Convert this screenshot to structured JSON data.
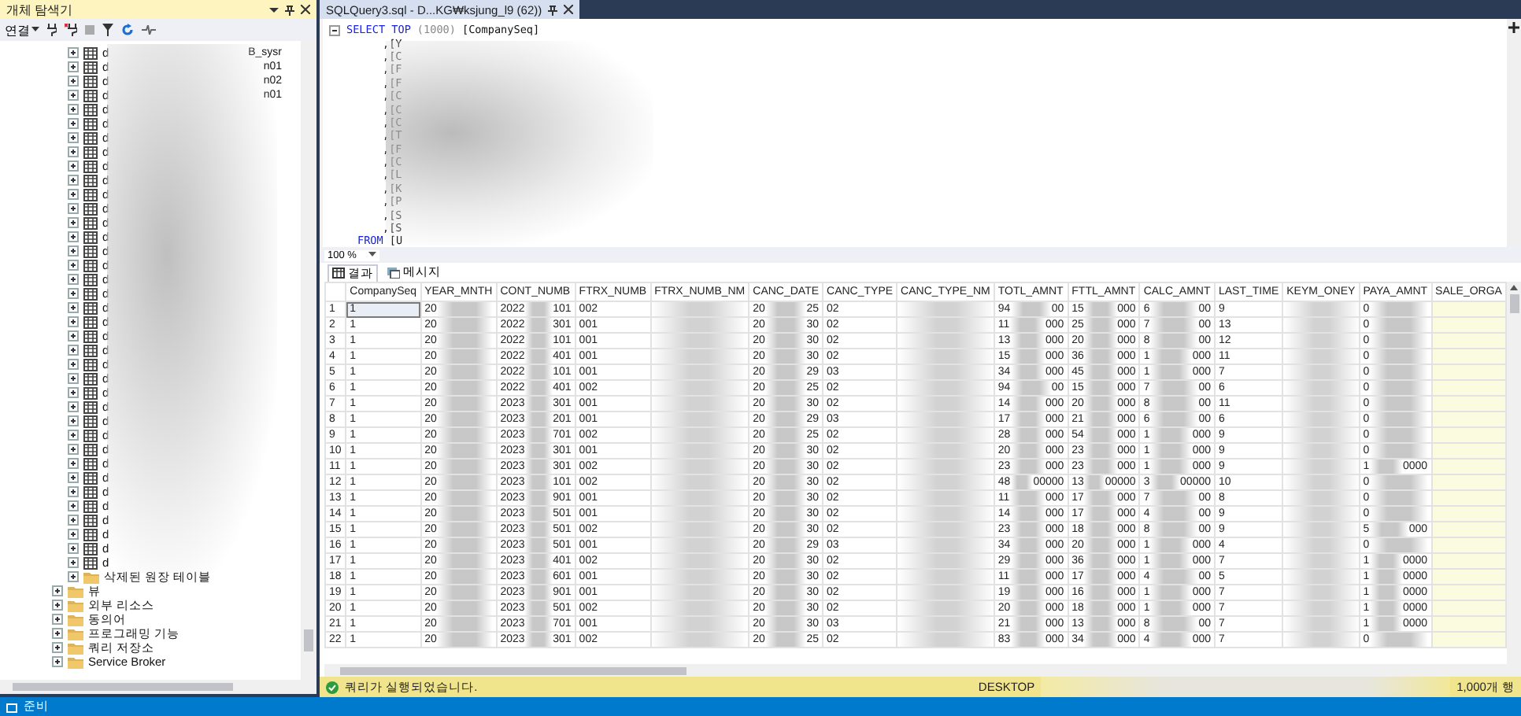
{
  "object_explorer": {
    "title": "개체 탐색기",
    "connect_label": "연결",
    "inner_items": [
      {
        "kind": "table",
        "label": "d",
        "suffix": "B_sysr"
      },
      {
        "kind": "table",
        "label": "d",
        "suffix": "n01"
      },
      {
        "kind": "table",
        "label": "d",
        "suffix": "n02"
      },
      {
        "kind": "table",
        "label": "d",
        "suffix": "n01"
      },
      {
        "kind": "table",
        "label": "d"
      },
      {
        "kind": "table",
        "label": "d"
      },
      {
        "kind": "table",
        "label": "d"
      },
      {
        "kind": "table",
        "label": "d"
      },
      {
        "kind": "table",
        "label": "d"
      },
      {
        "kind": "table",
        "label": "d"
      },
      {
        "kind": "table",
        "label": "d"
      },
      {
        "kind": "table",
        "label": "d"
      },
      {
        "kind": "table",
        "label": "d"
      },
      {
        "kind": "table",
        "label": "d"
      },
      {
        "kind": "table",
        "label": "d"
      },
      {
        "kind": "table",
        "label": "d"
      },
      {
        "kind": "table",
        "label": "d"
      },
      {
        "kind": "table",
        "label": "d"
      },
      {
        "kind": "table",
        "label": "d"
      },
      {
        "kind": "table",
        "label": "d"
      },
      {
        "kind": "table",
        "label": "d"
      },
      {
        "kind": "table",
        "label": "d"
      },
      {
        "kind": "table",
        "label": "d"
      },
      {
        "kind": "table",
        "label": "d"
      },
      {
        "kind": "table",
        "label": "d"
      },
      {
        "kind": "table",
        "label": "d"
      },
      {
        "kind": "table",
        "label": "d"
      },
      {
        "kind": "table",
        "label": "d"
      },
      {
        "kind": "table",
        "label": "d"
      },
      {
        "kind": "table",
        "label": "d"
      },
      {
        "kind": "table",
        "label": "d"
      },
      {
        "kind": "table",
        "label": "d"
      },
      {
        "kind": "table",
        "label": "d"
      },
      {
        "kind": "table",
        "label": "d"
      },
      {
        "kind": "table",
        "label": "d"
      },
      {
        "kind": "table",
        "label": "d"
      },
      {
        "kind": "table",
        "label": "d"
      },
      {
        "kind": "folder",
        "label": "삭제된 원장 테이블"
      }
    ],
    "outer_items": [
      {
        "kind": "folder",
        "label": "뷰"
      },
      {
        "kind": "folder",
        "label": "외부 리소스"
      },
      {
        "kind": "folder",
        "label": "동의어"
      },
      {
        "kind": "folder",
        "label": "프로그래밍 기능"
      },
      {
        "kind": "folder",
        "label": "쿼리 저장소"
      },
      {
        "kind": "folder",
        "label": "Service Broker"
      }
    ]
  },
  "editor": {
    "tab_title": "SQLQuery3.sql - D...KG₩ksjung_l9 (62))",
    "lines": [
      {
        "kind": "select",
        "collapsible": true,
        "parts": [
          {
            "kind": "keyword",
            "text": "SELECT TOP"
          },
          {
            "kind": "paren",
            "text": "(1000)"
          },
          {
            "kind": "plain",
            "text": "[CompanySeq]"
          }
        ]
      },
      {
        "kind": "column",
        "collapsible": false,
        "parts": [
          {
            "kind": "plain",
            "text": ",[Y"
          }
        ]
      },
      {
        "kind": "column",
        "collapsible": false,
        "parts": [
          {
            "kind": "plain",
            "text": ",[C"
          }
        ]
      },
      {
        "kind": "column",
        "collapsible": false,
        "parts": [
          {
            "kind": "plain",
            "text": ",[F"
          }
        ]
      },
      {
        "kind": "column",
        "collapsible": false,
        "parts": [
          {
            "kind": "plain",
            "text": ",[F"
          }
        ]
      },
      {
        "kind": "column",
        "collapsible": false,
        "parts": [
          {
            "kind": "plain",
            "text": ",[C"
          }
        ]
      },
      {
        "kind": "column",
        "collapsible": false,
        "parts": [
          {
            "kind": "plain",
            "text": ",[C"
          }
        ]
      },
      {
        "kind": "column",
        "collapsible": false,
        "parts": [
          {
            "kind": "plain",
            "text": ",[C"
          }
        ]
      },
      {
        "kind": "column",
        "collapsible": false,
        "parts": [
          {
            "kind": "plain",
            "text": ",[T"
          }
        ]
      },
      {
        "kind": "column",
        "collapsible": false,
        "parts": [
          {
            "kind": "plain",
            "text": ",[F"
          }
        ]
      },
      {
        "kind": "column",
        "collapsible": false,
        "parts": [
          {
            "kind": "plain",
            "text": ",[C"
          }
        ]
      },
      {
        "kind": "column",
        "collapsible": false,
        "parts": [
          {
            "kind": "plain",
            "text": ",[L"
          }
        ]
      },
      {
        "kind": "column",
        "collapsible": false,
        "parts": [
          {
            "kind": "plain",
            "text": ",[K"
          }
        ]
      },
      {
        "kind": "column",
        "collapsible": false,
        "parts": [
          {
            "kind": "plain",
            "text": ",[P"
          }
        ]
      },
      {
        "kind": "column",
        "collapsible": false,
        "parts": [
          {
            "kind": "plain",
            "text": ",[S"
          }
        ]
      },
      {
        "kind": "column",
        "collapsible": false,
        "parts": [
          {
            "kind": "plain",
            "text": ",[S"
          }
        ]
      },
      {
        "kind": "from",
        "collapsible": false,
        "parts": [
          {
            "kind": "keyword",
            "text": "FROM"
          },
          {
            "kind": "plain",
            "text": "[U"
          }
        ]
      }
    ],
    "zoom": "100 %"
  },
  "results": {
    "tabs": [
      {
        "kind": "grid",
        "label": "결과",
        "selected": true
      },
      {
        "kind": "messages",
        "label": "메시지",
        "selected": false
      }
    ],
    "columns": [
      {
        "name": "CompanySeq",
        "kind": "text"
      },
      {
        "name": "YEAR_MNTH",
        "kind": "redacted"
      },
      {
        "name": "CONT_NUMB",
        "kind": "redacted"
      },
      {
        "name": "FTRX_NUMB",
        "kind": "text"
      },
      {
        "name": "FTRX_NUMB_NM",
        "kind": "masked"
      },
      {
        "name": "CANC_DATE",
        "kind": "redacted"
      },
      {
        "name": "CANC_TYPE",
        "kind": "text"
      },
      {
        "name": "CANC_TYPE_NM",
        "kind": "masked"
      },
      {
        "name": "TOTL_AMNT",
        "kind": "redacted"
      },
      {
        "name": "FTTL_AMNT",
        "kind": "redacted"
      },
      {
        "name": "CALC_AMNT",
        "kind": "redacted"
      },
      {
        "name": "LAST_TIME",
        "kind": "text"
      },
      {
        "name": "KEYM_ONEY",
        "kind": "masked"
      },
      {
        "name": "PAYA_AMNT",
        "kind": "redacted"
      },
      {
        "name": "SALE_ORGA",
        "kind": "highlight"
      }
    ],
    "rows": [
      {
        "number": "1",
        "selected": true,
        "cells": [
          "1",
          "20",
          [
            "2022",
            "101"
          ],
          "002",
          "",
          [
            "20",
            "25"
          ],
          "02",
          "",
          [
            "94",
            "00"
          ],
          [
            "15",
            "000"
          ],
          [
            "6",
            "00"
          ],
          "9",
          "",
          "0",
          ""
        ]
      },
      {
        "number": "2",
        "selected": false,
        "cells": [
          "1",
          "20",
          [
            "2022",
            "301"
          ],
          "001",
          "",
          [
            "20",
            "30"
          ],
          "02",
          "",
          [
            "11",
            "000"
          ],
          [
            "25",
            "000"
          ],
          [
            "7",
            "00"
          ],
          "13",
          "",
          "0",
          ""
        ]
      },
      {
        "number": "3",
        "selected": false,
        "cells": [
          "1",
          "20",
          [
            "2022",
            "101"
          ],
          "001",
          "",
          [
            "20",
            "30"
          ],
          "02",
          "",
          [
            "13",
            "000"
          ],
          [
            "20",
            "000"
          ],
          [
            "8",
            "00"
          ],
          "12",
          "",
          "0",
          ""
        ]
      },
      {
        "number": "4",
        "selected": false,
        "cells": [
          "1",
          "20",
          [
            "2022",
            "401"
          ],
          "001",
          "",
          [
            "20",
            "30"
          ],
          "02",
          "",
          [
            "15",
            "000"
          ],
          [
            "36",
            "000"
          ],
          [
            "1",
            "000"
          ],
          "11",
          "",
          "0",
          ""
        ]
      },
      {
        "number": "5",
        "selected": false,
        "cells": [
          "1",
          "20",
          [
            "2022",
            "101"
          ],
          "001",
          "",
          [
            "20",
            "29"
          ],
          "03",
          "",
          [
            "34",
            "000"
          ],
          [
            "45",
            "000"
          ],
          [
            "1",
            "000"
          ],
          "7",
          "",
          "0",
          ""
        ]
      },
      {
        "number": "6",
        "selected": false,
        "cells": [
          "1",
          "20",
          [
            "2022",
            "401"
          ],
          "002",
          "",
          [
            "20",
            "25"
          ],
          "02",
          "",
          [
            "94",
            "00"
          ],
          [
            "15",
            "000"
          ],
          [
            "7",
            "00"
          ],
          "6",
          "",
          "0",
          ""
        ]
      },
      {
        "number": "7",
        "selected": false,
        "cells": [
          "1",
          "20",
          [
            "2023",
            "301"
          ],
          "001",
          "",
          [
            "20",
            "30"
          ],
          "02",
          "",
          [
            "14",
            "000"
          ],
          [
            "20",
            "000"
          ],
          [
            "8",
            "00"
          ],
          "11",
          "",
          "0",
          ""
        ]
      },
      {
        "number": "8",
        "selected": false,
        "cells": [
          "1",
          "20",
          [
            "2023",
            "201"
          ],
          "001",
          "",
          [
            "20",
            "29"
          ],
          "03",
          "",
          [
            "17",
            "000"
          ],
          [
            "21",
            "000"
          ],
          [
            "6",
            "00"
          ],
          "6",
          "",
          "0",
          ""
        ]
      },
      {
        "number": "9",
        "selected": false,
        "cells": [
          "1",
          "20",
          [
            "2023",
            "701"
          ],
          "002",
          "",
          [
            "20",
            "25"
          ],
          "02",
          "",
          [
            "28",
            "000"
          ],
          [
            "54",
            "000"
          ],
          [
            "1",
            "000"
          ],
          "9",
          "",
          "0",
          ""
        ]
      },
      {
        "number": "10",
        "selected": false,
        "cells": [
          "1",
          "20",
          [
            "2023",
            "301"
          ],
          "001",
          "",
          [
            "20",
            "30"
          ],
          "02",
          "",
          [
            "20",
            "000"
          ],
          [
            "23",
            "000"
          ],
          [
            "1",
            "000"
          ],
          "9",
          "",
          "0",
          ""
        ]
      },
      {
        "number": "11",
        "selected": false,
        "cells": [
          "1",
          "20",
          [
            "2023",
            "301"
          ],
          "002",
          "",
          [
            "20",
            "30"
          ],
          "02",
          "",
          [
            "23",
            "000"
          ],
          [
            "23",
            "000"
          ],
          [
            "1",
            "000"
          ],
          "9",
          "",
          [
            "1",
            "0000"
          ],
          ""
        ]
      },
      {
        "number": "12",
        "selected": false,
        "cells": [
          "1",
          "20",
          [
            "2023",
            "101"
          ],
          "002",
          "",
          [
            "20",
            "30"
          ],
          "02",
          "",
          [
            "48",
            "00000"
          ],
          [
            "13",
            "00000"
          ],
          [
            "3",
            "00000"
          ],
          "10",
          "",
          "0",
          ""
        ]
      },
      {
        "number": "13",
        "selected": false,
        "cells": [
          "1",
          "20",
          [
            "2023",
            "901"
          ],
          "001",
          "",
          [
            "20",
            "30"
          ],
          "02",
          "",
          [
            "11",
            "000"
          ],
          [
            "17",
            "000"
          ],
          [
            "7",
            "00"
          ],
          "8",
          "",
          "0",
          ""
        ]
      },
      {
        "number": "14",
        "selected": false,
        "cells": [
          "1",
          "20",
          [
            "2023",
            "501"
          ],
          "001",
          "",
          [
            "20",
            "30"
          ],
          "02",
          "",
          [
            "14",
            "000"
          ],
          [
            "17",
            "000"
          ],
          [
            "4",
            "00"
          ],
          "9",
          "",
          "0",
          ""
        ]
      },
      {
        "number": "15",
        "selected": false,
        "cells": [
          "1",
          "20",
          [
            "2023",
            "501"
          ],
          "002",
          "",
          [
            "20",
            "30"
          ],
          "02",
          "",
          [
            "23",
            "000"
          ],
          [
            "18",
            "000"
          ],
          [
            "8",
            "00"
          ],
          "9",
          "",
          [
            "5",
            "000"
          ],
          ""
        ]
      },
      {
        "number": "16",
        "selected": false,
        "cells": [
          "1",
          "20",
          [
            "2023",
            "501"
          ],
          "001",
          "",
          [
            "20",
            "29"
          ],
          "03",
          "",
          [
            "34",
            "000"
          ],
          [
            "20",
            "000"
          ],
          [
            "1",
            "000"
          ],
          "4",
          "",
          "0",
          ""
        ]
      },
      {
        "number": "17",
        "selected": false,
        "cells": [
          "1",
          "20",
          [
            "2023",
            "401"
          ],
          "002",
          "",
          [
            "20",
            "30"
          ],
          "02",
          "",
          [
            "29",
            "000"
          ],
          [
            "36",
            "000"
          ],
          [
            "1",
            "000"
          ],
          "7",
          "",
          [
            "1",
            "0000"
          ],
          ""
        ]
      },
      {
        "number": "18",
        "selected": false,
        "cells": [
          "1",
          "20",
          [
            "2023",
            "601"
          ],
          "001",
          "",
          [
            "20",
            "30"
          ],
          "02",
          "",
          [
            "11",
            "000"
          ],
          [
            "17",
            "000"
          ],
          [
            "4",
            "00"
          ],
          "5",
          "",
          [
            "1",
            "0000"
          ],
          ""
        ]
      },
      {
        "number": "19",
        "selected": false,
        "cells": [
          "1",
          "20",
          [
            "2023",
            "901"
          ],
          "001",
          "",
          [
            "20",
            "30"
          ],
          "02",
          "",
          [
            "19",
            "000"
          ],
          [
            "16",
            "000"
          ],
          [
            "1",
            "000"
          ],
          "7",
          "",
          [
            "1",
            "0000"
          ],
          ""
        ]
      },
      {
        "number": "20",
        "selected": false,
        "cells": [
          "1",
          "20",
          [
            "2023",
            "501"
          ],
          "002",
          "",
          [
            "20",
            "30"
          ],
          "02",
          "",
          [
            "20",
            "000"
          ],
          [
            "18",
            "000"
          ],
          [
            "1",
            "000"
          ],
          "7",
          "",
          [
            "1",
            "0000"
          ],
          ""
        ]
      },
      {
        "number": "21",
        "selected": false,
        "cells": [
          "1",
          "20",
          [
            "2023",
            "701"
          ],
          "001",
          "",
          [
            "20",
            "30"
          ],
          "03",
          "",
          [
            "21",
            "000"
          ],
          [
            "13",
            "000"
          ],
          [
            "8",
            "00"
          ],
          "7",
          "",
          [
            "1",
            "0000"
          ],
          ""
        ]
      },
      {
        "number": "22",
        "selected": false,
        "cells": [
          "1",
          "20",
          [
            "2023",
            "301"
          ],
          "002",
          "",
          [
            "20",
            "25"
          ],
          "02",
          "",
          [
            "83",
            "000"
          ],
          [
            "34",
            "000"
          ],
          [
            "4",
            "000"
          ],
          "7",
          "",
          "0",
          ""
        ]
      }
    ]
  },
  "query_status": {
    "message": "쿼리가 실행되었습니다.",
    "server": "DESKTOP",
    "row_count": "1,000개 행"
  },
  "status_bar": {
    "text": "준비"
  }
}
